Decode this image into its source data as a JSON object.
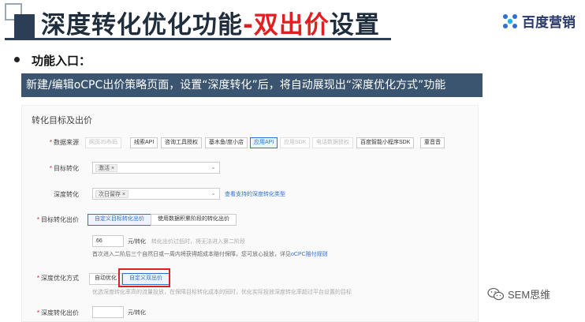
{
  "slide": {
    "title_main": "深度转化优化功能",
    "title_dash": "-",
    "title_highlight": "双出价",
    "title_tail": "设置",
    "brand": "百度营销",
    "entry_heading": "功能入口：",
    "banner_text": "新建/编辑oCPC出价策略页面，设置“深度转化”后，将自动展现出“深度优化方式”功能"
  },
  "form": {
    "section_title": "转化目标及出价",
    "data_source": {
      "label": "数据来源",
      "options": [
        {
          "label": "网页JS布码",
          "state": "disabled"
        },
        {
          "label": "线索API",
          "state": "normal"
        },
        {
          "label": "咨询工具授权",
          "state": "normal"
        },
        {
          "label": "基木鱼/度小店",
          "state": "normal"
        },
        {
          "label": "应用API",
          "state": "active"
        },
        {
          "label": "应用SDK",
          "state": "disabled"
        },
        {
          "label": "电话数据授权",
          "state": "disabled"
        },
        {
          "label": "百度智能小程序SDK",
          "state": "normal"
        },
        {
          "label": "童音音",
          "state": "normal"
        }
      ]
    },
    "target_conversion": {
      "label": "目标转化",
      "tag": "激活 ×"
    },
    "deep_conversion": {
      "label": "深度转化",
      "tag": "次日留存 ×",
      "link": "查看支持的深度转化类型"
    },
    "target_bid": {
      "label": "目标转化出价",
      "options": [
        {
          "label": "自定义目标转化出价",
          "state": "active"
        },
        {
          "label": "使用数据积累阶段的转化出价",
          "state": "normal"
        }
      ],
      "value": "66",
      "unit": "元/转化",
      "hint": "转化出价过低时，将无法进入第二阶段",
      "note_prefix": "首次进入二阶后三个自然日或一周内将获得超成本赔付保障，您可放心投放，详见",
      "note_link": "oCPC赔付规则"
    },
    "deep_method": {
      "label": "深度优化方式",
      "options": [
        {
          "label": "自动优化",
          "state": "normal"
        },
        {
          "label": "自定义双出价",
          "state": "active"
        }
      ],
      "desc": "优选深度转化率高的流量投放，在保障目标转化成本的同时，优化实际投放深度转化率超过平台设置的目标"
    },
    "deep_bid": {
      "label": "深度转化出价",
      "unit": "元/转化"
    }
  },
  "watermark": {
    "text": "SEM思维"
  },
  "colors": {
    "accent": "#e02020",
    "banner": "#3b5570",
    "link": "#2d6fd6",
    "title": "#1f2d3d"
  }
}
